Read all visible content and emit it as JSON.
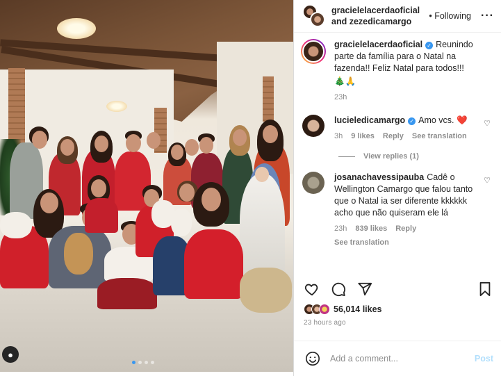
{
  "header": {
    "owner_line1": "gracielelacerdaoficial",
    "owner_line2": "and zezedicamargo",
    "follow_state": "• Following",
    "more_icon": "more-horizontal-icon"
  },
  "caption": {
    "username": "gracielelacerdaoficial",
    "text": "Reunindo parte da família para o Natal na fazenda!! Feliz Natal para todos!!!",
    "emoji": "🎄🙏",
    "time": "23h"
  },
  "comments": [
    {
      "username": "lucieledicamargo",
      "verified": true,
      "text": "Amo vcs. ❤️",
      "time": "3h",
      "likes": "9 likes",
      "reply": "Reply",
      "translation": "See translation",
      "view_replies": "View replies (1)"
    },
    {
      "username": "josanachavessipauba",
      "verified": false,
      "text": "Cadê o Wellington Camargo que falou tanto que o Natal ia ser diferente kkkkkk acho que não quiseram ele lá",
      "time": "23h",
      "likes": "839 likes",
      "reply": "Reply",
      "translation": "See translation"
    }
  ],
  "actions": {
    "like_icon": "heart-icon",
    "comment_icon": "comment-icon",
    "share_icon": "send-icon",
    "save_icon": "bookmark-icon"
  },
  "likes": "56,014 likes",
  "posted": "23 hours ago",
  "add_comment": {
    "placeholder": "Add a comment...",
    "post_label": "Post"
  },
  "carousel": {
    "total": 4,
    "active": 0
  },
  "colors": {
    "link": "#0095f6",
    "muted": "#8e8e8e",
    "heart": "#ed4956",
    "verified": "#3897f0"
  }
}
